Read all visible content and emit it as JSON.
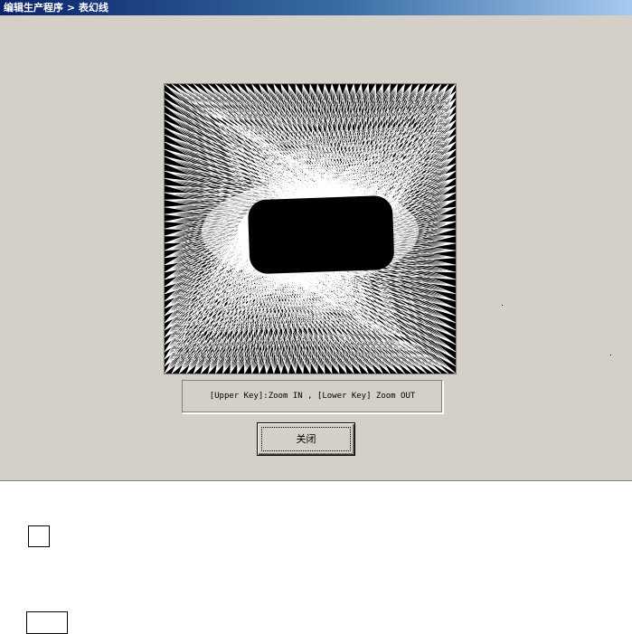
{
  "window": {
    "title": "编辑生产程序 > 表幻线"
  },
  "canvas": {
    "description_icon": "radial-line-pattern-icon"
  },
  "hint": {
    "text": "[Upper Key]:Zoom IN , [Lower Key] Zoom OUT"
  },
  "buttons": {
    "close_label": "关闭"
  },
  "colors": {
    "title_start": "#0a246a",
    "title_end": "#a6caf0",
    "window_bg": "#d4d0c8"
  }
}
